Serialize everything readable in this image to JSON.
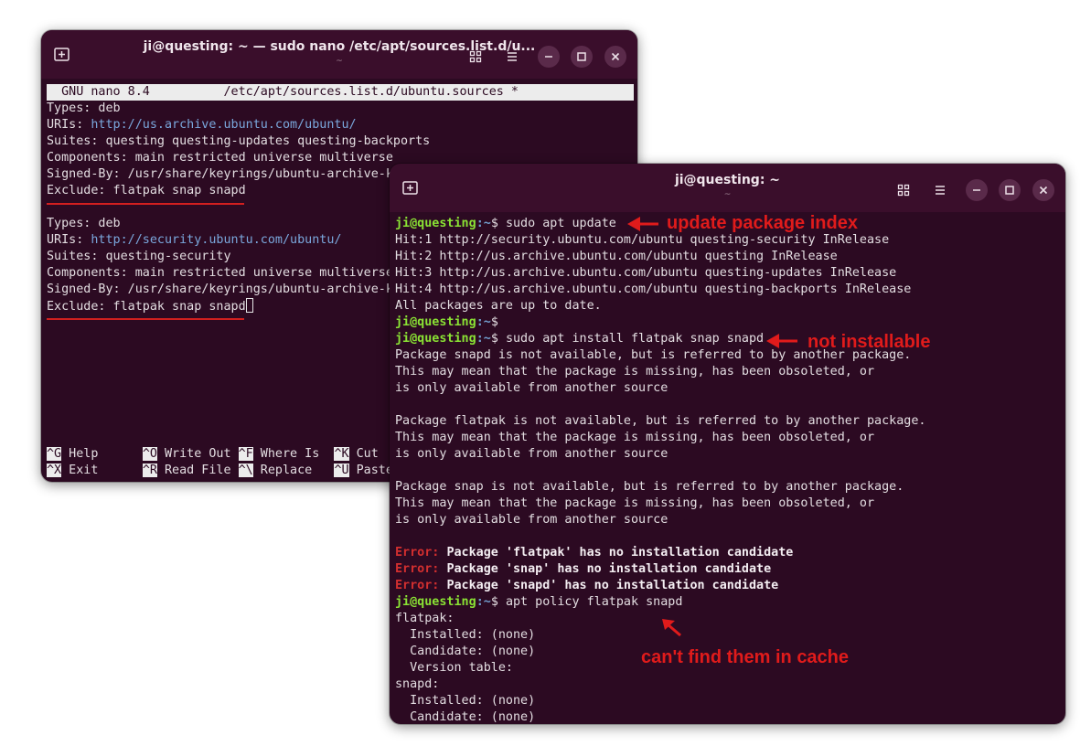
{
  "nano_window": {
    "title": "ji@questing: ~ — sudo nano /etc/apt/sources.list.d/u...",
    "subtitle": "~",
    "header": "  GNU nano 8.4          /etc/apt/sources.list.d/ubuntu.sources *",
    "lines": [
      {
        "pre": "Types: deb",
        "url": ""
      },
      {
        "pre": "URIs: ",
        "url": "http://us.archive.ubuntu.com/ubuntu/"
      },
      {
        "pre": "Suites: questing questing-updates questing-backports",
        "url": ""
      },
      {
        "pre": "Components: main restricted universe multiverse",
        "url": ""
      },
      {
        "pre": "Signed-By: /usr/share/keyrings/ubuntu-archive-k",
        "url": ""
      },
      {
        "pre": "Exclude: flatpak snap snapd",
        "url": ""
      },
      {
        "pre": "",
        "url": ""
      },
      {
        "pre": "Types: deb",
        "url": ""
      },
      {
        "pre": "URIs: ",
        "url": "http://security.ubuntu.com/ubuntu/"
      },
      {
        "pre": "Suites: questing-security",
        "url": ""
      },
      {
        "pre": "Components: main restricted universe multiverse",
        "url": ""
      },
      {
        "pre": "Signed-By: /usr/share/keyrings/ubuntu-archive-k",
        "url": ""
      },
      {
        "pre": "Exclude: flatpak snap snapd",
        "url": ""
      }
    ],
    "shortcuts_row1": [
      {
        "key": "^G",
        "label": " Help      "
      },
      {
        "key": "^O",
        "label": " Write Out "
      },
      {
        "key": "^F",
        "label": " Where Is  "
      },
      {
        "key": "^K",
        "label": " Cut"
      }
    ],
    "shortcuts_row2": [
      {
        "key": "^X",
        "label": " Exit      "
      },
      {
        "key": "^R",
        "label": " Read File "
      },
      {
        "key": "^\\",
        "label": " Replace   "
      },
      {
        "key": "^U",
        "label": " Paste"
      }
    ]
  },
  "term_window": {
    "title": "ji@questing: ~",
    "subtitle": "~",
    "prompt_user": "ji@questing",
    "prompt_path": ":~",
    "prompt_sign": "$ ",
    "lines": [
      {
        "type": "prompt",
        "cmd": "sudo apt update"
      },
      {
        "type": "text",
        "text": "Hit:1 http://security.ubuntu.com/ubuntu questing-security InRelease"
      },
      {
        "type": "text",
        "text": "Hit:2 http://us.archive.ubuntu.com/ubuntu questing InRelease"
      },
      {
        "type": "text",
        "text": "Hit:3 http://us.archive.ubuntu.com/ubuntu questing-updates InRelease"
      },
      {
        "type": "text",
        "text": "Hit:4 http://us.archive.ubuntu.com/ubuntu questing-backports InRelease"
      },
      {
        "type": "text",
        "text": "All packages are up to date."
      },
      {
        "type": "prompt",
        "cmd": ""
      },
      {
        "type": "prompt",
        "cmd": "sudo apt install flatpak snap snapd"
      },
      {
        "type": "text",
        "text": "Package snapd is not available, but is referred to by another package."
      },
      {
        "type": "text",
        "text": "This may mean that the package is missing, has been obsoleted, or"
      },
      {
        "type": "text",
        "text": "is only available from another source"
      },
      {
        "type": "text",
        "text": ""
      },
      {
        "type": "text",
        "text": "Package flatpak is not available, but is referred to by another package."
      },
      {
        "type": "text",
        "text": "This may mean that the package is missing, has been obsoleted, or"
      },
      {
        "type": "text",
        "text": "is only available from another source"
      },
      {
        "type": "text",
        "text": ""
      },
      {
        "type": "text",
        "text": "Package snap is not available, but is referred to by another package."
      },
      {
        "type": "text",
        "text": "This may mean that the package is missing, has been obsoleted, or"
      },
      {
        "type": "text",
        "text": "is only available from another source"
      },
      {
        "type": "text",
        "text": ""
      },
      {
        "type": "error",
        "kw": "Error: ",
        "text": "Package 'flatpak' has no installation candidate"
      },
      {
        "type": "error",
        "kw": "Error: ",
        "text": "Package 'snap' has no installation candidate"
      },
      {
        "type": "error",
        "kw": "Error: ",
        "text": "Package 'snapd' has no installation candidate"
      },
      {
        "type": "prompt",
        "cmd": "apt policy flatpak snapd"
      },
      {
        "type": "text",
        "text": "flatpak:"
      },
      {
        "type": "text",
        "text": "  Installed: (none)"
      },
      {
        "type": "text",
        "text": "  Candidate: (none)"
      },
      {
        "type": "text",
        "text": "  Version table:"
      },
      {
        "type": "text",
        "text": "snapd:"
      },
      {
        "type": "text",
        "text": "  Installed: (none)"
      },
      {
        "type": "text",
        "text": "  Candidate: (none)"
      }
    ]
  },
  "annotations": {
    "update": "update package index",
    "not_installable": "not installable",
    "cache": "can't find them in cache",
    "color": "#e01b1b"
  },
  "icons": {
    "new_tab": "new-tab-icon",
    "view": "grid-view-icon",
    "menu": "hamburger-menu-icon",
    "minimize": "minimize-icon",
    "maximize": "maximize-icon",
    "close": "close-icon"
  }
}
